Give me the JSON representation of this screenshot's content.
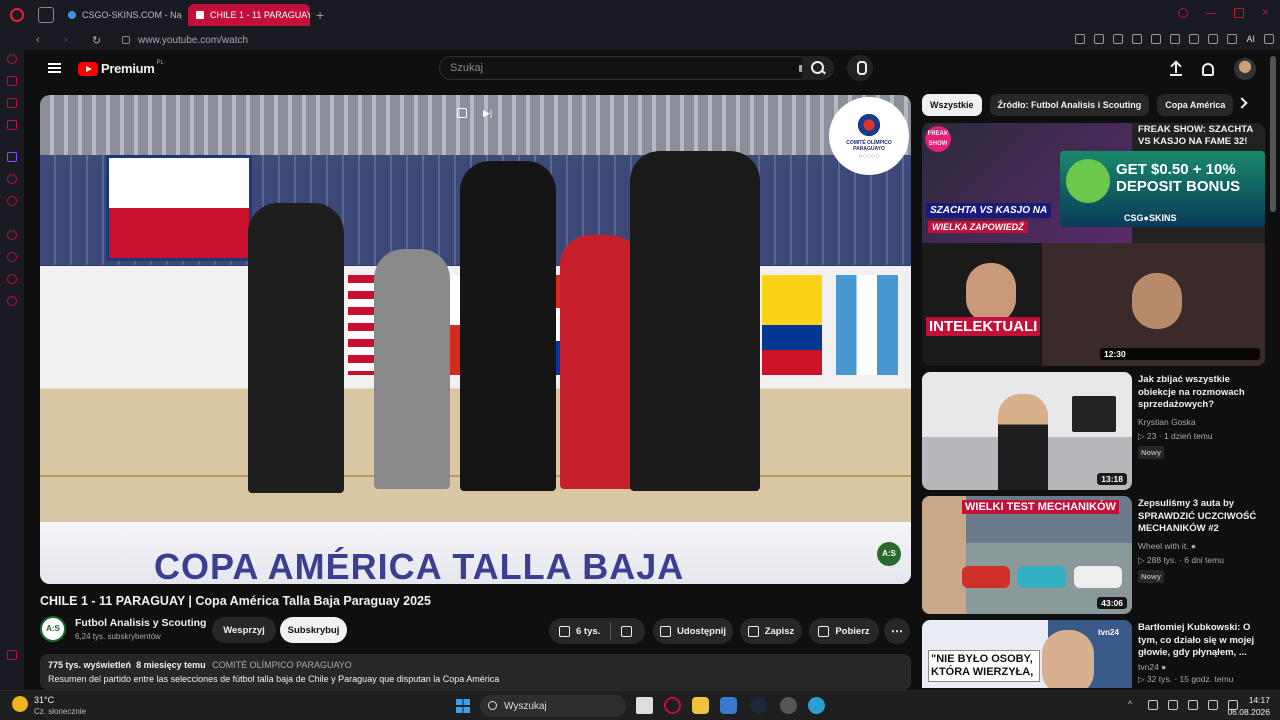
{
  "browser": {
    "tabs": [
      {
        "label": "CSGO-SKINS.COM - Najlep",
        "active": false
      },
      {
        "label": "CHILE 1 - 11 PARAGUAY",
        "active": true
      }
    ],
    "url": "www.youtube.com/watch",
    "ai_label": "AI",
    "accent": "#c2103a"
  },
  "yt": {
    "logo_text": "Premium",
    "logo_sup": "PL",
    "search_placeholder": "Szukaj"
  },
  "player": {
    "overlay_text": "COPA AMÉRICA TALLA BAJA",
    "logo_text": "COMITÉ OLÍMPICO PARAGUAYO",
    "badge": "A:S"
  },
  "video": {
    "title": "CHILE 1 - 11 PARAGUAY | Copa América Talla Baja Paraguay 2025",
    "channel": "Futbol Analisis y Scouting",
    "channel_avatar": "A:S",
    "subscribers": "6,24 tys. subskrybentów",
    "support_label": "Wesprzyj",
    "subscribe_label": "Subskrybuj",
    "likes": "6 tys.",
    "share_label": "Udostępnij",
    "save_label": "Zapisz",
    "download_label": "Pobierz",
    "views": "775 tys. wyświetleń",
    "age": "8 miesięcy temu",
    "tag": "COMITÉ OLÍMPICO PARAGUAYO",
    "description": "Resumen del partido entre las selecciones de fútbol talla baja de Chile y Paraguay que disputan la Copa América"
  },
  "chips": [
    "Wszystkie",
    "Źródło: Futbol Analisis i Scouting",
    "Copa América"
  ],
  "ad": {
    "title": "FREAK SHOW: SZACHTA VS KASJO NA FAME 32!",
    "freak_label": "FREAK SHOW",
    "thumb_text_1": "SZACHTA VS KASJO NA",
    "thumb_text_2": "WIELKA ZAPOWIEDŹ",
    "banner_text_1": "GET $0.50 + 10%",
    "banner_text_2": "DEPOSIT BONUS",
    "banner_brand": "CSG●SKINS",
    "lower_text": "INTELEKTUALI",
    "duration": "12:30"
  },
  "recommendations": [
    {
      "title": "Jak zbijać wszystkie obiekcje na rozmowach sprzedażowych?",
      "channel": "Krystian Goska",
      "views": "23",
      "age": "1 dzień temu",
      "badge": "Nowy",
      "duration": "13:18"
    },
    {
      "title": "Zepsuliśmy 3 auta by SPRAWDZIĆ UCZCIWOŚĆ MECHANIKÓW #2",
      "channel": "Wheel with it.",
      "views": "288 tys.",
      "age": "6 dni temu",
      "badge": "Nowy",
      "duration": "43:06",
      "thumb_text": "WIELKI TEST MECHANIKÓW"
    },
    {
      "title": "Bartłomiej Kubkowski: O tym, co działo się w mojej głowie, gdy płynąłem, ...",
      "channel": "tvn24",
      "views": "32 tys.",
      "age": "15 godz. temu",
      "thumb_text": "\"NIE BYŁO OSOBY, KTÓRA WIERZYŁA,",
      "thumb_logo": "tvn24"
    }
  ],
  "taskbar": {
    "temp": "31°C",
    "weather": "Cz. słonecznie",
    "search": "Wyszukaj",
    "time": "14:17",
    "date": "06.08.2026"
  }
}
